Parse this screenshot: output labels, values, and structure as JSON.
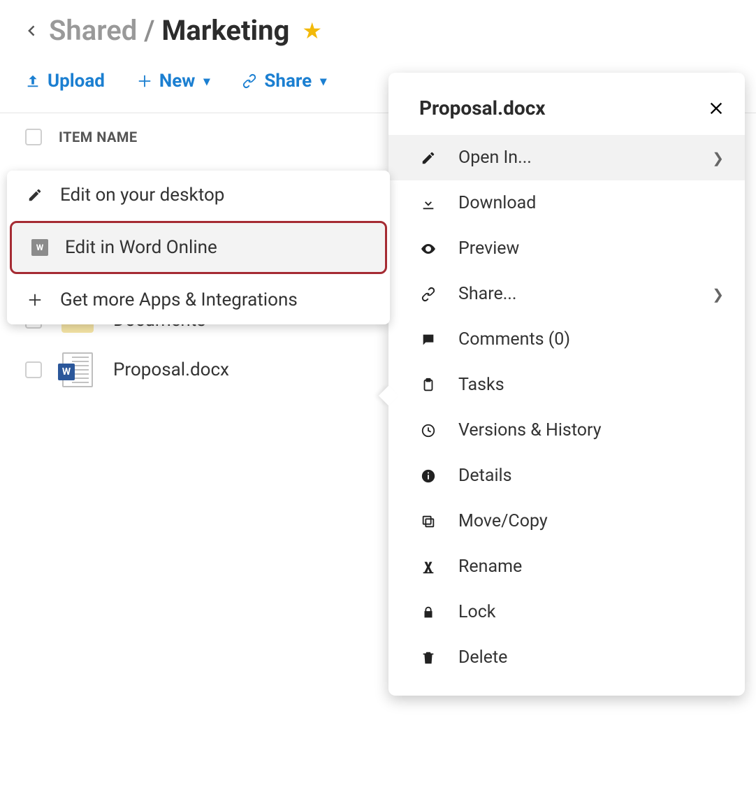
{
  "breadcrumb": {
    "parent": "Shared",
    "separator": "/",
    "current": "Marketing"
  },
  "toolbar": {
    "upload": "Upload",
    "new": "New",
    "share": "Share"
  },
  "list": {
    "column_header": "ITEM NAME",
    "rows": [
      {
        "name": "Documents",
        "type": "folder"
      },
      {
        "name": "Proposal.docx",
        "type": "word"
      }
    ]
  },
  "open_in_flyout": {
    "items": [
      {
        "label": "Edit on your desktop",
        "icon": "pencil"
      },
      {
        "label": "Edit in Word Online",
        "icon": "word",
        "highlight": true
      },
      {
        "label": "Get more Apps & Integrations",
        "icon": "plus"
      }
    ]
  },
  "context_menu": {
    "title": "Proposal.docx",
    "items": [
      {
        "label": "Open In...",
        "icon": "pencil",
        "submenu": true,
        "active": true
      },
      {
        "label": "Download",
        "icon": "download"
      },
      {
        "label": "Preview",
        "icon": "eye"
      },
      {
        "label": "Share...",
        "icon": "link",
        "submenu": true
      },
      {
        "label": "Comments (0)",
        "icon": "comment"
      },
      {
        "label": "Tasks",
        "icon": "clipboard"
      },
      {
        "label": "Versions & History",
        "icon": "clock"
      },
      {
        "label": "Details",
        "icon": "info"
      },
      {
        "label": "Move/Copy",
        "icon": "copy"
      },
      {
        "label": "Rename",
        "icon": "rename"
      },
      {
        "label": "Lock",
        "icon": "lock"
      },
      {
        "label": "Delete",
        "icon": "trash"
      }
    ]
  }
}
